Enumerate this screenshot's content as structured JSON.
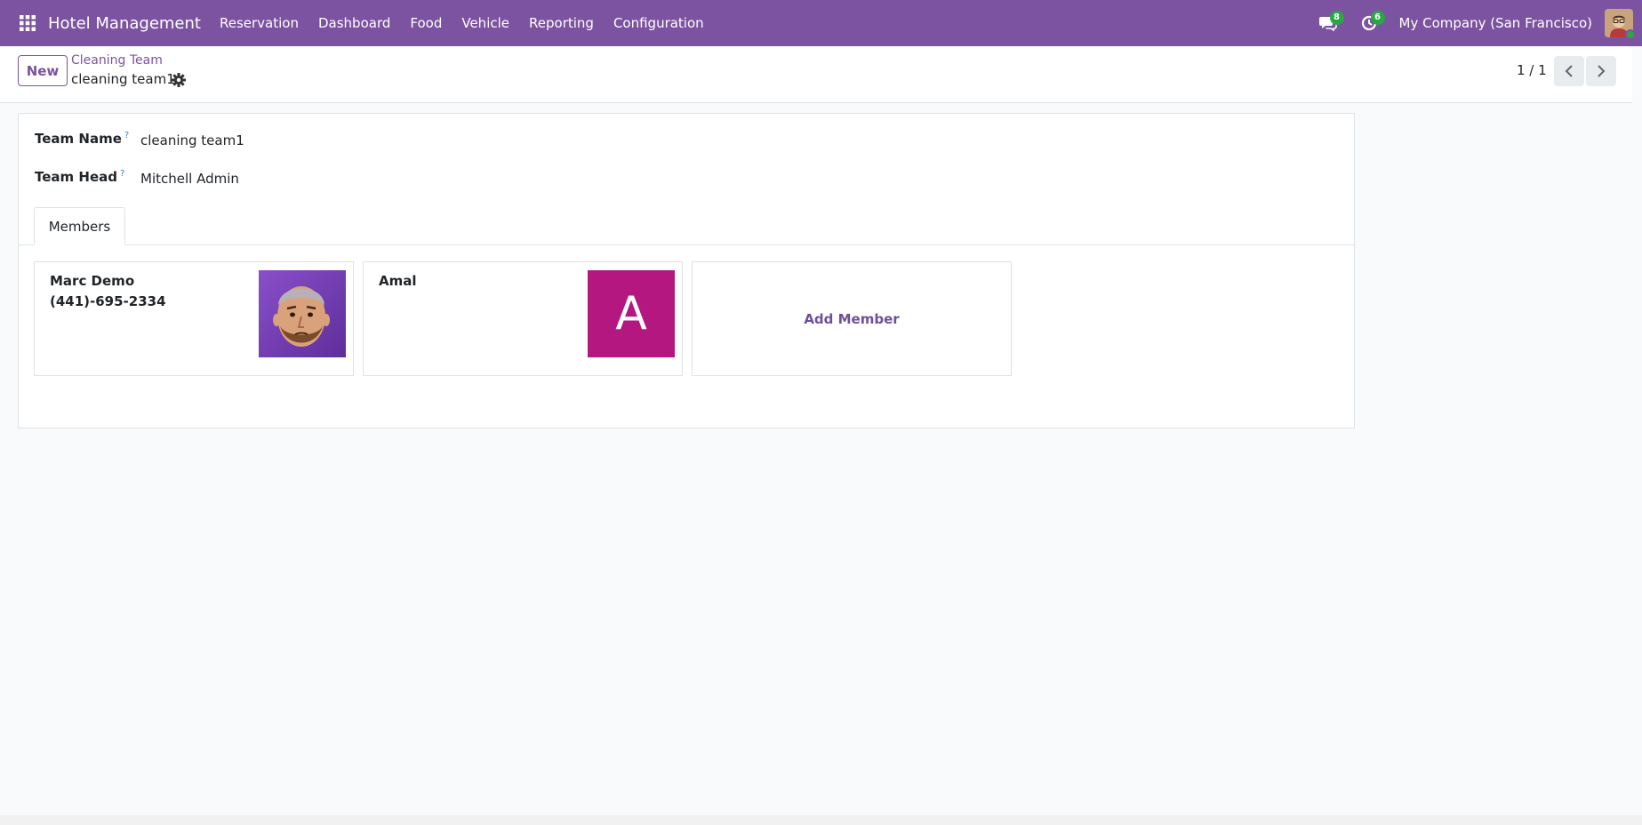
{
  "navbar": {
    "app_name": "Hotel Management",
    "menu": [
      "Reservation",
      "Dashboard",
      "Food",
      "Vehicle",
      "Reporting",
      "Configuration"
    ],
    "messages_count": "8",
    "activities_count": "6",
    "company": "My Company (San Francisco)",
    "accent_color": "#7c53a0"
  },
  "control_panel": {
    "new_label": "New",
    "breadcrumb_parent": "Cleaning Team",
    "breadcrumb_current": "cleaning team1",
    "pager": "1 / 1"
  },
  "form": {
    "team_name_label": "Team Name",
    "team_name_help": "?",
    "team_name_value": "cleaning team1",
    "team_head_label": "Team Head",
    "team_head_help": "?",
    "team_head_value": "Mitchell Admin",
    "tab_members": "Members",
    "members": [
      {
        "name": "Marc Demo",
        "phone": "(441)-695-2334",
        "avatar": "photo-avatar"
      },
      {
        "name": "Amal",
        "phone": "",
        "avatar_letter": "A",
        "avatar_color": "#b4177f"
      }
    ],
    "add_member_label": "Add Member"
  }
}
